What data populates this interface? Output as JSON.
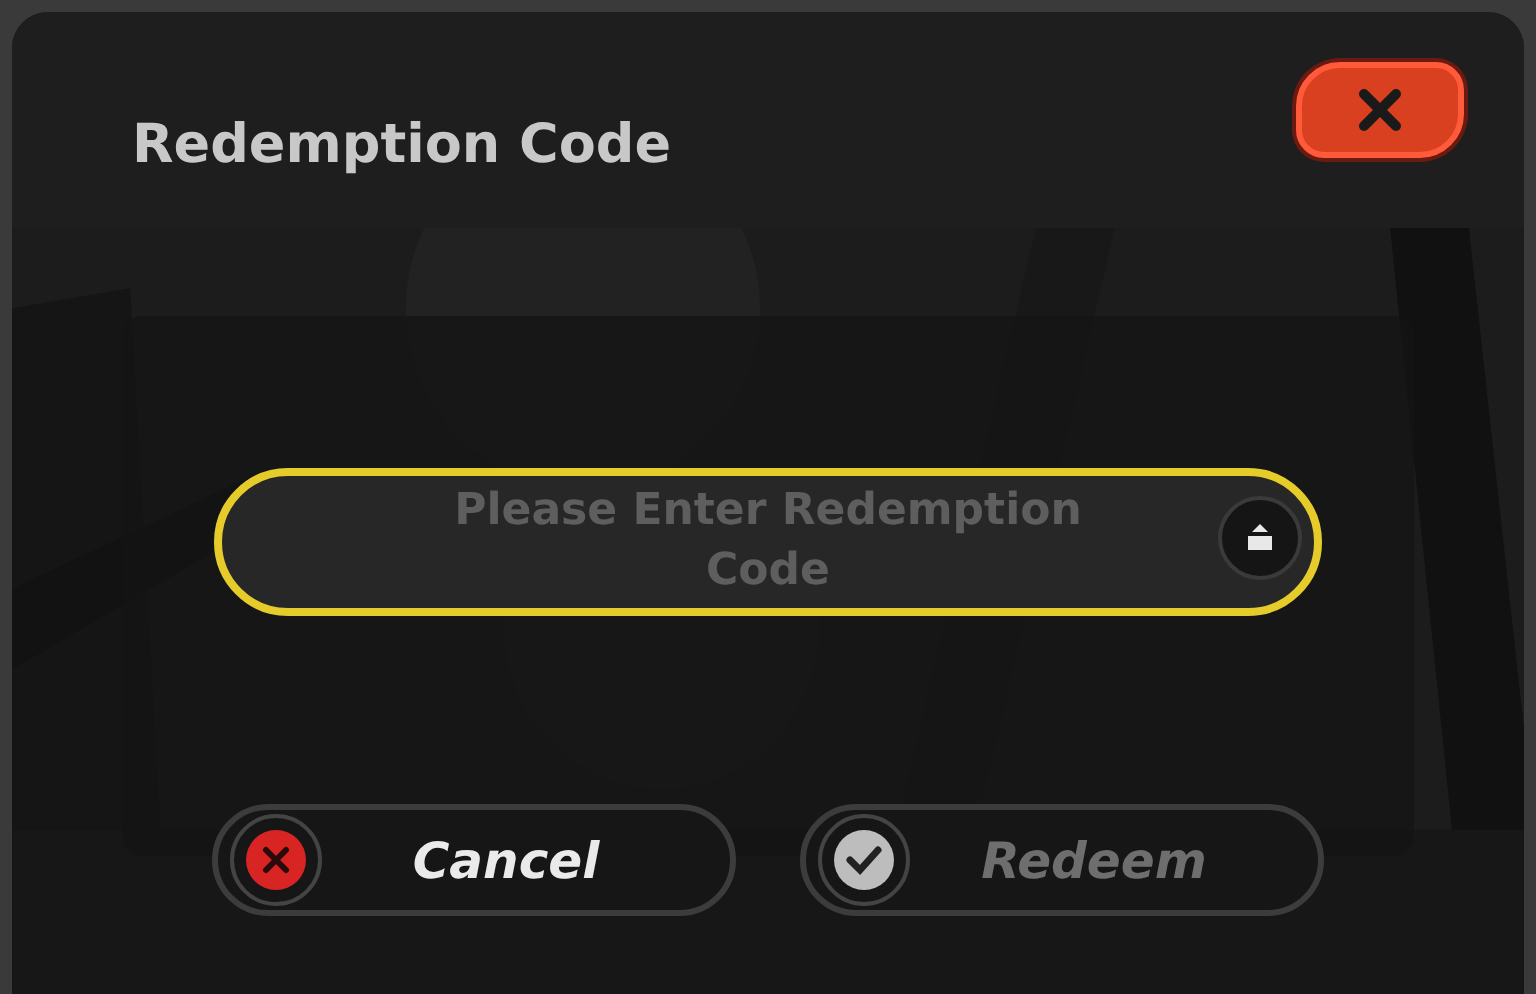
{
  "dialog": {
    "title": "Redemption Code"
  },
  "code_field": {
    "placeholder": "Please Enter Redemption Code"
  },
  "buttons": [
    {
      "kind": "cancel",
      "label": "Cancel",
      "disabled": false
    },
    {
      "kind": "confirm",
      "label": "Redeem",
      "disabled": true
    }
  ]
}
